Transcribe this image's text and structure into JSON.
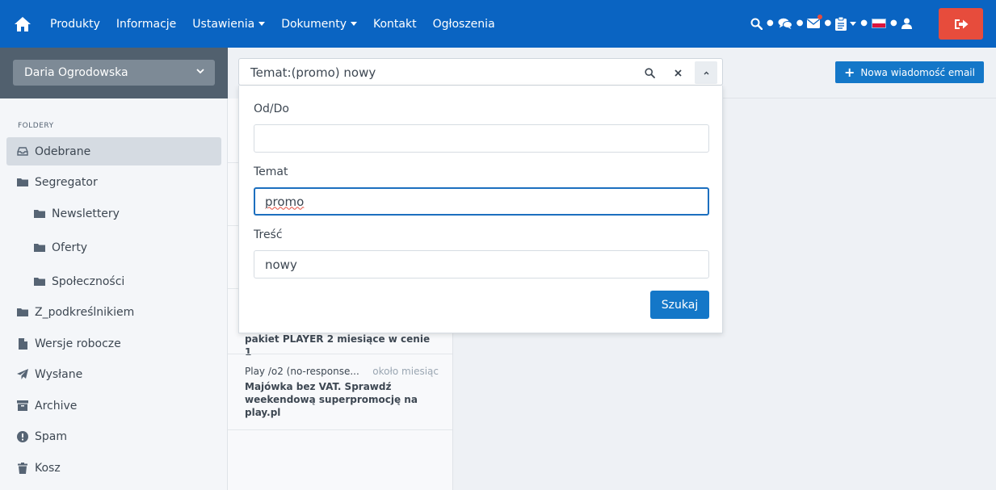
{
  "nav": {
    "home_icon": "home-icon",
    "items": [
      {
        "label": "Produkty",
        "dropdown": false
      },
      {
        "label": "Informacje",
        "dropdown": false
      },
      {
        "label": "Ustawienia",
        "dropdown": true
      },
      {
        "label": "Dokumenty",
        "dropdown": true
      },
      {
        "label": "Kontakt",
        "dropdown": false
      },
      {
        "label": "Ogłoszenia",
        "dropdown": false
      }
    ],
    "right_icons": [
      "search-icon",
      "chat-icon",
      "mail-icon",
      "clipboard-icon",
      "flag-pl-icon",
      "user-icon"
    ],
    "logout_icon": "logout-icon"
  },
  "user": {
    "name": "Daria Ogrodowska"
  },
  "sidebar": {
    "title": "FOLDERY",
    "folders": [
      {
        "label": "Odebrane",
        "icon": "inbox-icon",
        "active": true,
        "sub": false
      },
      {
        "label": "Segregator",
        "icon": "folder-icon",
        "active": false,
        "sub": false
      },
      {
        "label": "Newslettery",
        "icon": "folder-icon",
        "active": false,
        "sub": true
      },
      {
        "label": "Oferty",
        "icon": "folder-icon",
        "active": false,
        "sub": true
      },
      {
        "label": "Społeczności",
        "icon": "folder-icon",
        "active": false,
        "sub": true
      },
      {
        "label": "Z_podkreślnikiem",
        "icon": "folder-icon",
        "active": false,
        "sub": false
      },
      {
        "label": "Wersje robocze",
        "icon": "file-icon",
        "active": false,
        "sub": false
      },
      {
        "label": "Wysłane",
        "icon": "paper-plane-icon",
        "active": false,
        "sub": false
      },
      {
        "label": "Archive",
        "icon": "archive-icon",
        "active": false,
        "sub": false
      },
      {
        "label": "Spam",
        "icon": "exclamation-circle-icon",
        "active": false,
        "sub": false
      },
      {
        "label": "Kosz",
        "icon": "trash-icon",
        "active": false,
        "sub": false
      }
    ]
  },
  "messages": [
    {
      "sender": "",
      "time": "",
      "subject": "pakiet PLAYER 2 miesiące w cenie 1"
    },
    {
      "sender": "Play /o2 (no-response...",
      "time": "około miesiąc",
      "subject": "Majówka bez VAT. Sprawdź weekendową superpromocję na play.pl"
    }
  ],
  "toolbar": {
    "new_email_label": "Nowa wiadomość email"
  },
  "search": {
    "query": "Temat:(promo) nowy",
    "fields": [
      {
        "label": "Od/Do",
        "value": ""
      },
      {
        "label": "Temat",
        "value": "promo"
      },
      {
        "label": "Treść",
        "value": "nowy"
      }
    ],
    "submit_label": "Szukaj"
  },
  "colors": {
    "navbar": "#0a64c2",
    "logout": "#e74c3c",
    "primary_button": "#1477c8",
    "sidebar_header": "#51606e"
  }
}
